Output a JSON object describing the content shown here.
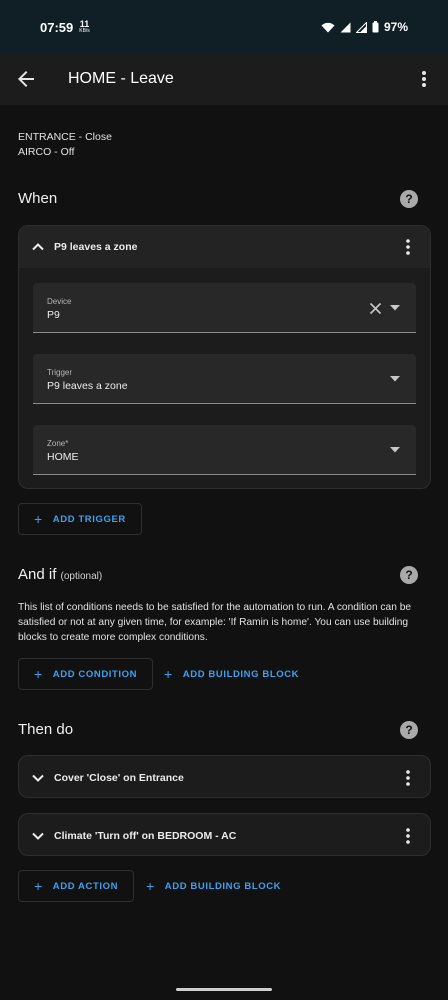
{
  "status_bar": {
    "time": "07:59",
    "net_speed": "11",
    "net_unit": "KB/s",
    "battery": "97%"
  },
  "app_bar": {
    "title": "HOME - Leave"
  },
  "description": {
    "line1": "ENTRANCE - Close",
    "line2": "AIRCO - Off"
  },
  "when": {
    "title": "When",
    "trigger_card": {
      "label": "P9 leaves a zone",
      "fields": [
        {
          "label": "Device",
          "value": "P9"
        },
        {
          "label": "Trigger",
          "value": "P9 leaves a zone"
        },
        {
          "label": "Zone*",
          "value": "HOME"
        }
      ]
    },
    "add_trigger": "ADD TRIGGER"
  },
  "and_if": {
    "title": "And if",
    "optional": "(optional)",
    "text": "This list of conditions needs to be satisfied for the automation to run. A condition can be satisfied or not at any given time, for example: 'If Ramin is home'. You can use building blocks to create more complex conditions.",
    "add_condition": "ADD CONDITION",
    "add_building_block": "ADD BUILDING BLOCK"
  },
  "then_do": {
    "title": "Then do",
    "actions": [
      {
        "label": "Cover 'Close' on Entrance"
      },
      {
        "label": "Climate 'Turn off' on BEDROOM - AC"
      }
    ],
    "add_action": "ADD ACTION",
    "add_building_block": "ADD BUILDING BLOCK"
  },
  "colors": {
    "accent": "#3aa1f0",
    "background": "#111111",
    "card": "#1c1c1c"
  },
  "icons": [
    "back-arrow-icon",
    "more-vert-icon",
    "help-icon",
    "chevron-up-icon",
    "chevron-down-icon",
    "close-icon",
    "caret-down-icon",
    "plus-icon",
    "wifi-icon",
    "signal-icon",
    "battery-icon"
  ]
}
